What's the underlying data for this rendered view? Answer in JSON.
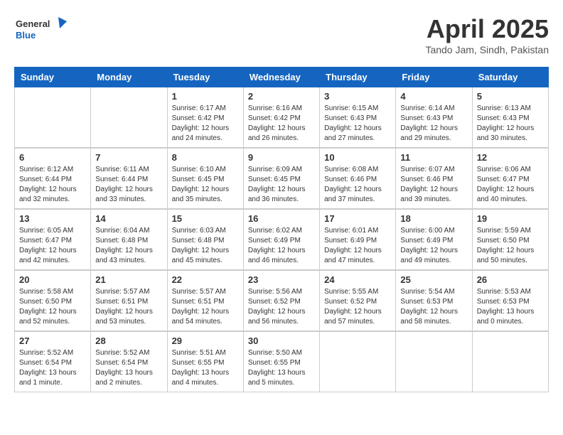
{
  "header": {
    "logo_line1": "General",
    "logo_line2": "Blue",
    "month": "April 2025",
    "location": "Tando Jam, Sindh, Pakistan"
  },
  "weekdays": [
    "Sunday",
    "Monday",
    "Tuesday",
    "Wednesday",
    "Thursday",
    "Friday",
    "Saturday"
  ],
  "weeks": [
    [
      {
        "day": "",
        "info": ""
      },
      {
        "day": "",
        "info": ""
      },
      {
        "day": "1",
        "info": "Sunrise: 6:17 AM\nSunset: 6:42 PM\nDaylight: 12 hours\nand 24 minutes."
      },
      {
        "day": "2",
        "info": "Sunrise: 6:16 AM\nSunset: 6:42 PM\nDaylight: 12 hours\nand 26 minutes."
      },
      {
        "day": "3",
        "info": "Sunrise: 6:15 AM\nSunset: 6:43 PM\nDaylight: 12 hours\nand 27 minutes."
      },
      {
        "day": "4",
        "info": "Sunrise: 6:14 AM\nSunset: 6:43 PM\nDaylight: 12 hours\nand 29 minutes."
      },
      {
        "day": "5",
        "info": "Sunrise: 6:13 AM\nSunset: 6:43 PM\nDaylight: 12 hours\nand 30 minutes."
      }
    ],
    [
      {
        "day": "6",
        "info": "Sunrise: 6:12 AM\nSunset: 6:44 PM\nDaylight: 12 hours\nand 32 minutes."
      },
      {
        "day": "7",
        "info": "Sunrise: 6:11 AM\nSunset: 6:44 PM\nDaylight: 12 hours\nand 33 minutes."
      },
      {
        "day": "8",
        "info": "Sunrise: 6:10 AM\nSunset: 6:45 PM\nDaylight: 12 hours\nand 35 minutes."
      },
      {
        "day": "9",
        "info": "Sunrise: 6:09 AM\nSunset: 6:45 PM\nDaylight: 12 hours\nand 36 minutes."
      },
      {
        "day": "10",
        "info": "Sunrise: 6:08 AM\nSunset: 6:46 PM\nDaylight: 12 hours\nand 37 minutes."
      },
      {
        "day": "11",
        "info": "Sunrise: 6:07 AM\nSunset: 6:46 PM\nDaylight: 12 hours\nand 39 minutes."
      },
      {
        "day": "12",
        "info": "Sunrise: 6:06 AM\nSunset: 6:47 PM\nDaylight: 12 hours\nand 40 minutes."
      }
    ],
    [
      {
        "day": "13",
        "info": "Sunrise: 6:05 AM\nSunset: 6:47 PM\nDaylight: 12 hours\nand 42 minutes."
      },
      {
        "day": "14",
        "info": "Sunrise: 6:04 AM\nSunset: 6:48 PM\nDaylight: 12 hours\nand 43 minutes."
      },
      {
        "day": "15",
        "info": "Sunrise: 6:03 AM\nSunset: 6:48 PM\nDaylight: 12 hours\nand 45 minutes."
      },
      {
        "day": "16",
        "info": "Sunrise: 6:02 AM\nSunset: 6:49 PM\nDaylight: 12 hours\nand 46 minutes."
      },
      {
        "day": "17",
        "info": "Sunrise: 6:01 AM\nSunset: 6:49 PM\nDaylight: 12 hours\nand 47 minutes."
      },
      {
        "day": "18",
        "info": "Sunrise: 6:00 AM\nSunset: 6:49 PM\nDaylight: 12 hours\nand 49 minutes."
      },
      {
        "day": "19",
        "info": "Sunrise: 5:59 AM\nSunset: 6:50 PM\nDaylight: 12 hours\nand 50 minutes."
      }
    ],
    [
      {
        "day": "20",
        "info": "Sunrise: 5:58 AM\nSunset: 6:50 PM\nDaylight: 12 hours\nand 52 minutes."
      },
      {
        "day": "21",
        "info": "Sunrise: 5:57 AM\nSunset: 6:51 PM\nDaylight: 12 hours\nand 53 minutes."
      },
      {
        "day": "22",
        "info": "Sunrise: 5:57 AM\nSunset: 6:51 PM\nDaylight: 12 hours\nand 54 minutes."
      },
      {
        "day": "23",
        "info": "Sunrise: 5:56 AM\nSunset: 6:52 PM\nDaylight: 12 hours\nand 56 minutes."
      },
      {
        "day": "24",
        "info": "Sunrise: 5:55 AM\nSunset: 6:52 PM\nDaylight: 12 hours\nand 57 minutes."
      },
      {
        "day": "25",
        "info": "Sunrise: 5:54 AM\nSunset: 6:53 PM\nDaylight: 12 hours\nand 58 minutes."
      },
      {
        "day": "26",
        "info": "Sunrise: 5:53 AM\nSunset: 6:53 PM\nDaylight: 13 hours\nand 0 minutes."
      }
    ],
    [
      {
        "day": "27",
        "info": "Sunrise: 5:52 AM\nSunset: 6:54 PM\nDaylight: 13 hours\nand 1 minute."
      },
      {
        "day": "28",
        "info": "Sunrise: 5:52 AM\nSunset: 6:54 PM\nDaylight: 13 hours\nand 2 minutes."
      },
      {
        "day": "29",
        "info": "Sunrise: 5:51 AM\nSunset: 6:55 PM\nDaylight: 13 hours\nand 4 minutes."
      },
      {
        "day": "30",
        "info": "Sunrise: 5:50 AM\nSunset: 6:55 PM\nDaylight: 13 hours\nand 5 minutes."
      },
      {
        "day": "",
        "info": ""
      },
      {
        "day": "",
        "info": ""
      },
      {
        "day": "",
        "info": ""
      }
    ]
  ]
}
